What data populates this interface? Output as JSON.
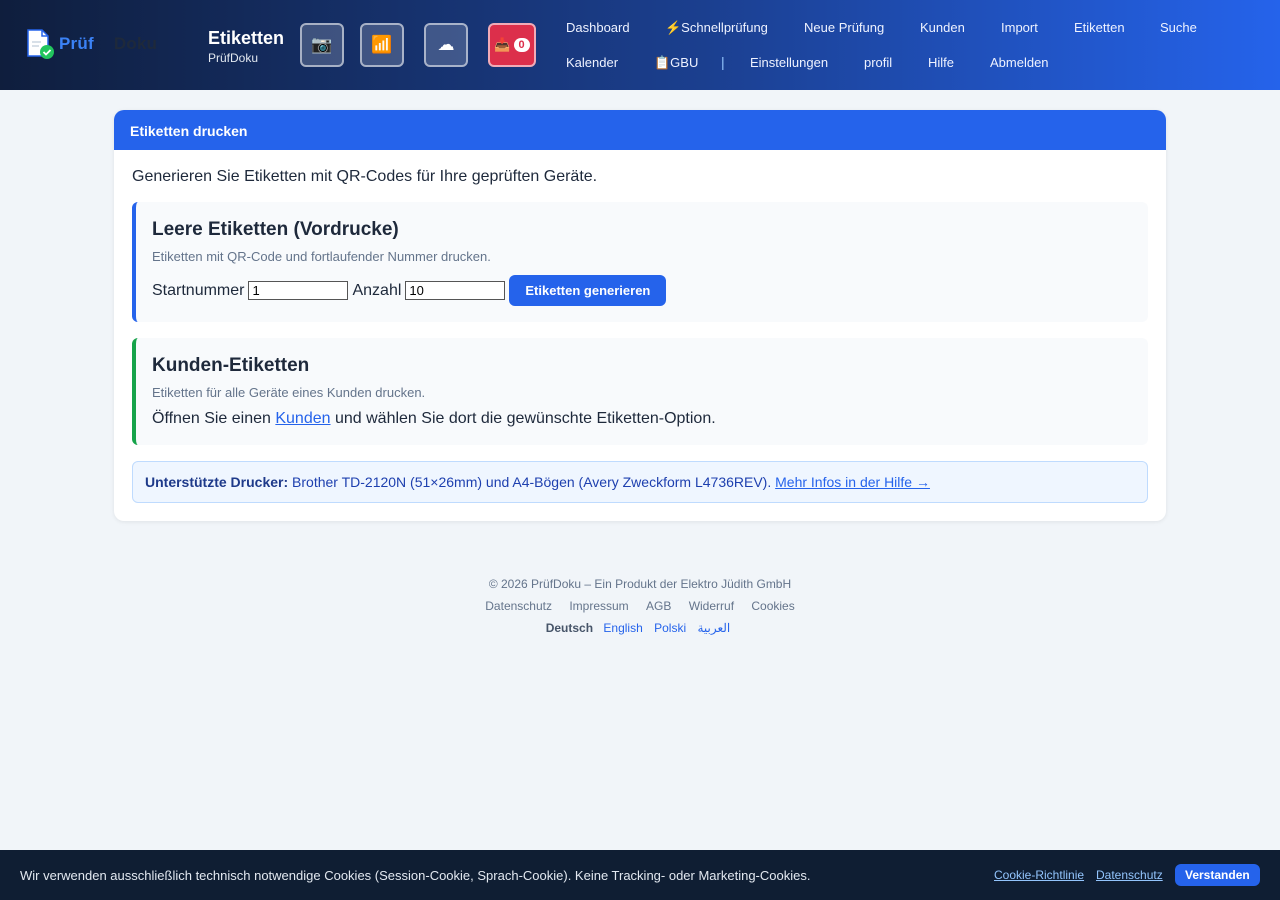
{
  "header": {
    "logo": {
      "part1": "Prüf",
      "part2": "Doku"
    },
    "title": "Etiketten",
    "subtitle": "PrüfDoku",
    "icons": {
      "camera": "📷",
      "wifi": "📶",
      "cloud": "☁",
      "inbox": "📥"
    },
    "inbox_count": "0"
  },
  "nav": {
    "dashboard": "Dashboard",
    "schnell": "⚡Schnellprüfung",
    "neue": "Neue Prüfung",
    "kunden": "Kunden",
    "import": "Import",
    "etiketten": "Etiketten",
    "suche": "Suche",
    "kalender": "Kalender",
    "gbu": "📋GBU",
    "separator": "|",
    "einstellungen": "Einstellungen",
    "profil": "profil",
    "hilfe": "Hilfe",
    "abmelden": "Abmelden"
  },
  "card": {
    "header": "Etiketten drucken",
    "intro": "Generieren Sie Etiketten mit QR-Codes für Ihre geprüften Geräte.",
    "blank": {
      "title": "Leere Etiketten (Vordrucke)",
      "description": "Etiketten mit QR-Code und fortlaufender Nummer drucken.",
      "start_label": "Startnummer",
      "start_value": "1",
      "count_label": "Anzahl",
      "count_value": "10",
      "button": "Etiketten generieren"
    },
    "customer": {
      "title": "Kunden-Etiketten",
      "description": "Etiketten für alle Geräte eines Kunden drucken.",
      "text_before": "Öffnen Sie einen ",
      "link": "Kunden",
      "text_after": " und wählen Sie dort die gewünschte Etiketten-Option."
    },
    "info": {
      "label": "Unterstützte Drucker:",
      "text": " Brother TD-2120N (51×26mm) und A4-Bögen (Avery Zweckform L4736REV). ",
      "link": "Mehr Infos in der Hilfe →"
    }
  },
  "footer": {
    "copyright": "© 2026 PrüfDoku – Ein Produkt der Elektro Jüdith GmbH",
    "links": [
      "Datenschutz",
      "Impressum",
      "AGB",
      "Widerruf",
      "Cookies"
    ],
    "languages": {
      "current": "Deutsch",
      "others": [
        "English",
        "Polski",
        "العربية"
      ]
    }
  },
  "cookie": {
    "message": "Wir verwenden ausschließlich technisch notwendige Cookies (Session-Cookie, Sprach-Cookie). Keine Tracking- oder Marketing-Cookies.",
    "policy_link": "Cookie-Richtlinie",
    "privacy_link": "Datenschutz",
    "accept": "Verstanden"
  },
  "colors": {
    "accent": "#2563eb",
    "success": "#16a34a",
    "danger": "#dc2f4b",
    "header_dark": "#0f1e3d",
    "cookie_bg": "#0f1e33"
  }
}
